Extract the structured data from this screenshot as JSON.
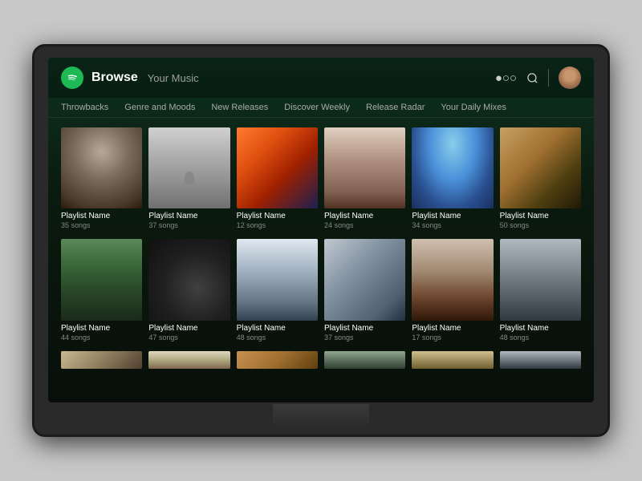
{
  "header": {
    "browse_label": "Browse",
    "your_music_label": "Your Music",
    "search_icon": "🔍"
  },
  "nav": {
    "tabs": [
      {
        "label": "Throwbacks"
      },
      {
        "label": "Genre and Moods"
      },
      {
        "label": "New Releases"
      },
      {
        "label": "Discover Weekly"
      },
      {
        "label": "Release Radar"
      },
      {
        "label": "Your Daily Mixes"
      }
    ]
  },
  "playlists": {
    "row1": [
      {
        "name": "Playlist Name",
        "songs": "35 songs",
        "thumb": "thumb-1"
      },
      {
        "name": "Playlist Name",
        "songs": "37 songs",
        "thumb": "thumb-2"
      },
      {
        "name": "Playlist Name",
        "songs": "12 songs",
        "thumb": "thumb-3"
      },
      {
        "name": "Playlist Name",
        "songs": "24 songs",
        "thumb": "thumb-4"
      },
      {
        "name": "Playlist Name",
        "songs": "34 songs",
        "thumb": "thumb-5"
      },
      {
        "name": "Playlist Name",
        "songs": "50 songs",
        "thumb": "thumb-6"
      }
    ],
    "row2": [
      {
        "name": "Playlist Name",
        "songs": "44 songs",
        "thumb": "thumb-7"
      },
      {
        "name": "Playlist Name",
        "songs": "47 songs",
        "thumb": "thumb-8"
      },
      {
        "name": "Playlist Name",
        "songs": "48 songs",
        "thumb": "thumb-9"
      },
      {
        "name": "Playlist Name",
        "songs": "37 songs",
        "thumb": "thumb-10"
      },
      {
        "name": "Playlist Name",
        "songs": "17 songs",
        "thumb": "thumb-11"
      },
      {
        "name": "Playlist Name",
        "songs": "48 songs",
        "thumb": "thumb-12"
      }
    ]
  }
}
